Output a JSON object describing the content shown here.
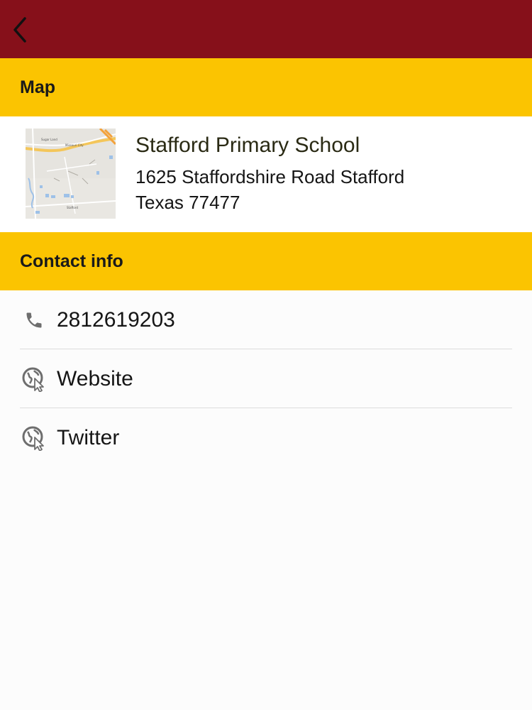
{
  "colors": {
    "topbar": "#86101a",
    "section_header": "#fbc401",
    "background": "#fcfcfc"
  },
  "topbar": {
    "back_icon": "chevron-left-icon"
  },
  "map_section": {
    "header": "Map",
    "map_thumbnail": {
      "icon": "map-thumbnail",
      "labels": [
        "Missouri City",
        "Sugar Land",
        "Stafford"
      ]
    },
    "school_name": "Stafford Primary School",
    "address_line1": "1625 Staffordshire Road Stafford",
    "address_line2": "Texas 77477"
  },
  "contact_section": {
    "header": "Contact info",
    "items": [
      {
        "label": "2812619203",
        "icon": "phone-icon"
      },
      {
        "label": "Website",
        "icon": "globe-cursor-icon"
      },
      {
        "label": "Twitter",
        "icon": "globe-cursor-icon"
      }
    ]
  }
}
